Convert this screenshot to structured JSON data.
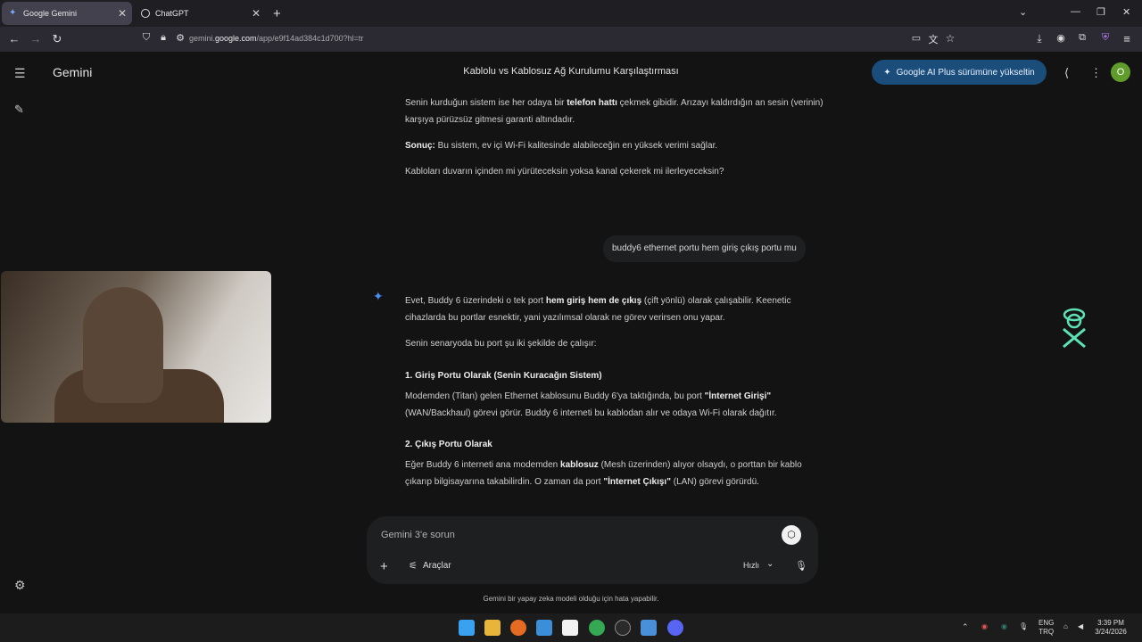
{
  "browser": {
    "tabs": [
      {
        "title": "Google Gemini",
        "active": true
      },
      {
        "title": "ChatGPT",
        "active": false
      }
    ],
    "url_prefix": "gemini.",
    "url_domain": "google.com",
    "url_path": "/app/e9f14ad384c1d700?hl=tr"
  },
  "app": {
    "brand": "Gemini",
    "conversation_title": "Kablolu vs Kablosuz Ağ Kurulumu Karşılaştırması",
    "upgrade_label": "Google AI Plus sürümüne yükseltin",
    "avatar_initial": "O",
    "accent_color": "#1b4d7a"
  },
  "messages": {
    "prev_p1a": "Senin kurduğun sistem ise her odaya bir",
    "prev_p1b": "telefon hattı",
    "prev_p1c": "çekmek gibidir. Arızayı kaldırdığın an sesin (verinin) karşıya pürüzsüz gitmesi garanti altındadır.",
    "prev_p2a": "Sonuç:",
    "prev_p2b": "Bu sistem, ev içi Wi-Fi kalitesinde alabileceğin en yüksek verimi sağlar.",
    "prev_p3": "Kabloları duvarın içinden mi yürüteceksin yoksa kanal çekerek mi ilerleyeceksin?",
    "user": "buddy6 ethernet portu hem giriş çıkış portu mu",
    "a_p1a": "Evet, Buddy 6 üzerindeki o tek port",
    "a_p1b": "hem giriş hem de çıkış",
    "a_p1c": "(çift yönlü) olarak çalışabilir. Keenetic cihazlarda bu portlar esnektir, yani yazılımsal olarak ne görev verirsen onu yapar.",
    "a_p2": "Senin senaryoda bu port şu iki şekilde de çalışır:",
    "a_h1": "1. Giriş Portu Olarak (Senin Kuracağın Sistem)",
    "a_p3a": "Modemden (Titan) gelen Ethernet kablosunu Buddy 6'ya taktığında, bu port",
    "a_p3b": "\"İnternet Girişi\"",
    "a_p3c": "(WAN/Backhaul) görevi görür. Buddy 6 interneti bu kablodan alır ve odaya Wi-Fi olarak dağıtır.",
    "a_h2": "2. Çıkış Portu Olarak",
    "a_p4a": "Eğer Buddy 6 interneti ana modemden",
    "a_p4b": "kablosuz",
    "a_p4c": "(Mesh üzerinden) alıyor olsaydı, o porttan bir kablo çıkarıp bilgisayarına takabilirdin. O zaman da port",
    "a_p4d": "\"İnternet Çıkışı\"",
    "a_p4e": "(LAN) görevi görürdü."
  },
  "input": {
    "placeholder": "Gemini 3'e sorun",
    "tools_label": "Araçlar",
    "mode_label": "Hızlı"
  },
  "disclaimer": "Gemini bir yapay zeka modeli olduğu için hata yapabilir.",
  "taskbar": {
    "lang_top": "ENG",
    "lang_bottom": "TRQ",
    "time": "3:39 PM",
    "date": "3/24/2026"
  }
}
